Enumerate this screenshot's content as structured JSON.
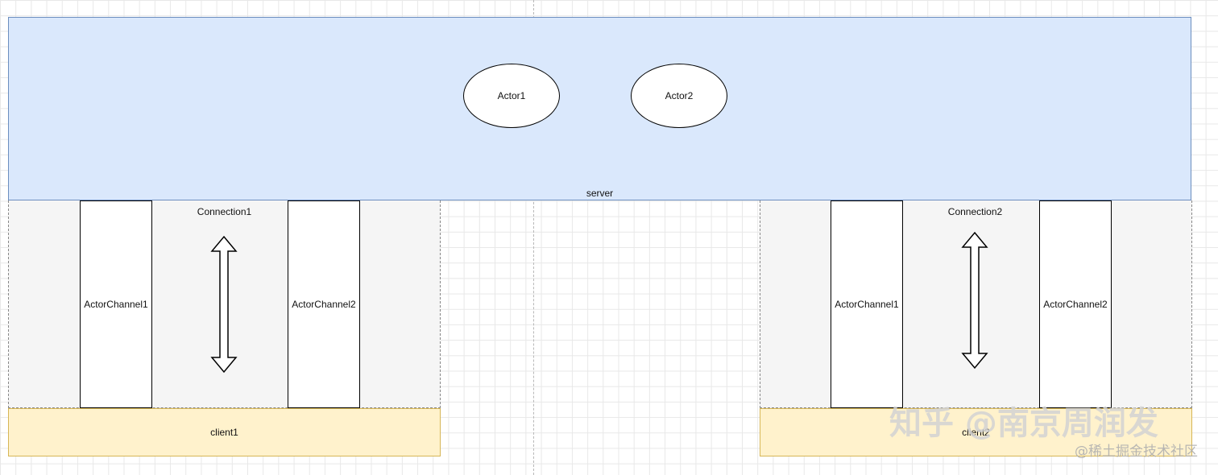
{
  "server": {
    "label": "server",
    "actors": [
      "Actor1",
      "Actor2"
    ]
  },
  "connections": [
    {
      "label": "Connection1",
      "channels": [
        "ActorChannel1",
        "ActorChannel2"
      ],
      "client": "client1"
    },
    {
      "label": "Connection2",
      "channels": [
        "ActorChannel1",
        "ActorChannel2"
      ],
      "client": "client2"
    }
  ],
  "watermark": {
    "main": "知乎 @南京周润发",
    "sub": "@稀土掘金技术社区"
  },
  "colors": {
    "server_fill": "#dae8fc",
    "server_stroke": "#6c8ebf",
    "client_fill": "#fff2cc",
    "client_stroke": "#d6b656",
    "connection_fill": "#f5f5f5"
  }
}
